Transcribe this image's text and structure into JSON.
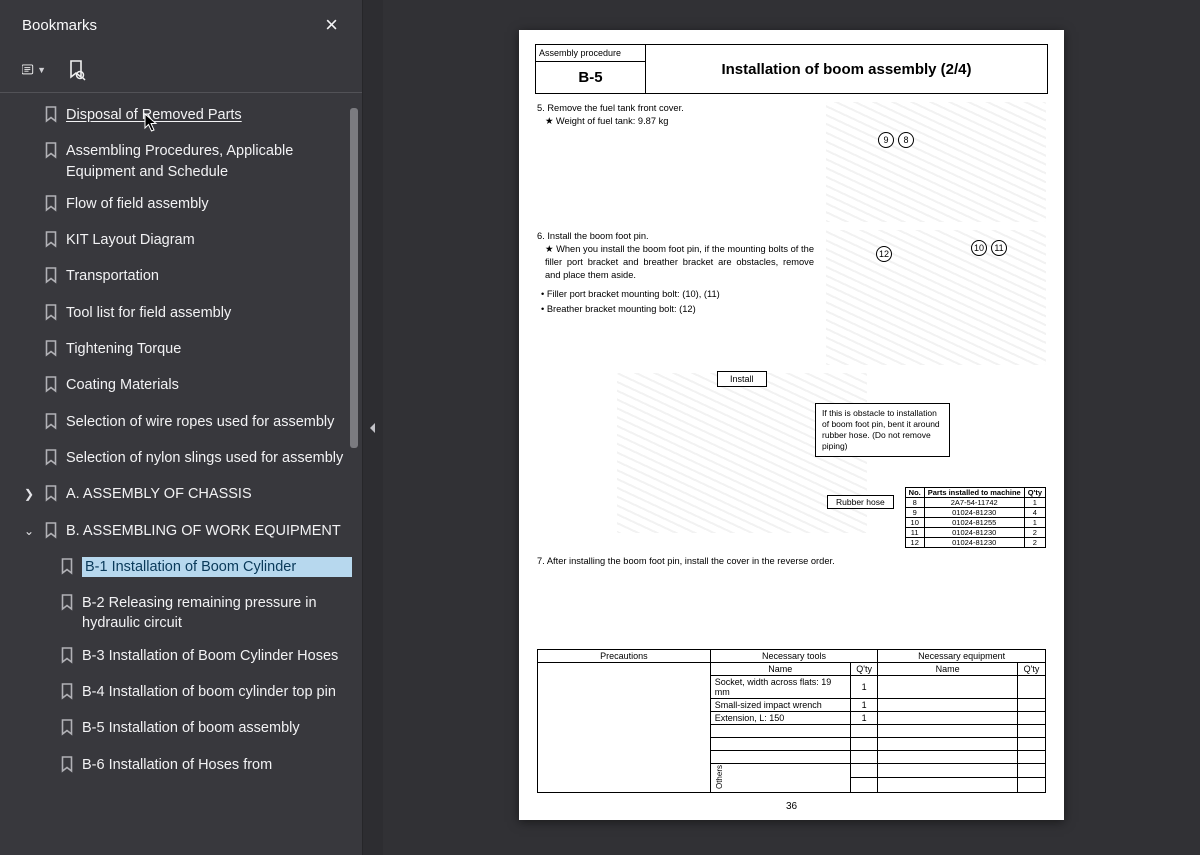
{
  "sidebar": {
    "title": "Bookmarks",
    "items": [
      {
        "label": "Disposal of Removed Parts",
        "lvl": 1,
        "expand": "",
        "underlined": true
      },
      {
        "label": "Assembling Procedures, Applicable Equipment and Schedule",
        "lvl": 1,
        "expand": ""
      },
      {
        "label": "Flow of field assembly",
        "lvl": 1,
        "expand": ""
      },
      {
        "label": "KIT Layout Diagram",
        "lvl": 1,
        "expand": ""
      },
      {
        "label": "Transportation",
        "lvl": 1,
        "expand": ""
      },
      {
        "label": "Tool list for field assembly",
        "lvl": 1,
        "expand": ""
      },
      {
        "label": "Tightening Torque",
        "lvl": 1,
        "expand": ""
      },
      {
        "label": "Coating Materials",
        "lvl": 1,
        "expand": ""
      },
      {
        "label": "Selection of wire ropes used for assembly",
        "lvl": 1,
        "expand": ""
      },
      {
        "label": "Selection of nylon slings used for assembly",
        "lvl": 1,
        "expand": ""
      },
      {
        "label": "A. ASSEMBLY OF CHASSIS",
        "lvl": 1,
        "expand": ">"
      },
      {
        "label": "B. ASSEMBLING OF WORK EQUIPMENT",
        "lvl": 1,
        "expand": "v"
      },
      {
        "label": "B-1  Installation of Boom Cylinder",
        "lvl": 2,
        "expand": "",
        "selected": true
      },
      {
        "label": "B-2  Releasing remaining pressure in hydraulic circuit",
        "lvl": 2,
        "expand": ""
      },
      {
        "label": "B-3  Installation of Boom Cylinder Hoses",
        "lvl": 2,
        "expand": ""
      },
      {
        "label": "B-4  Installation of boom cylinder top pin",
        "lvl": 2,
        "expand": ""
      },
      {
        "label": "B-5  Installation of boom assembly",
        "lvl": 2,
        "expand": ""
      },
      {
        "label": "B-6  Installation of Hoses from",
        "lvl": 2,
        "expand": ""
      }
    ]
  },
  "page": {
    "proc_label": "Assembly procedure",
    "code": "B-5",
    "title": "Installation of boom assembly (2/4)",
    "step5": {
      "text": "5. Remove the fuel tank front cover.",
      "sub": "★ Weight of fuel tank: 9.87 kg",
      "callouts": [
        "9",
        "8"
      ]
    },
    "step6": {
      "text": "6. Install the boom foot pin.",
      "sub": "★ When you install the boom foot pin, if the mounting bolts of the filler port bracket and breather bracket are obstacles, remove and place them aside.",
      "b1": "• Filler port bracket mounting bolt: (10), (11)",
      "b2": "• Breather bracket mounting bolt: (12)",
      "callouts": [
        "12",
        "10",
        "11"
      ]
    },
    "install_label": "Install",
    "note_box": "If this is obstacle to installation of boom foot pin, bent it around rubber hose.\n(Do not remove piping)",
    "rubber_label": "Rubber hose",
    "parts_table": {
      "headers": [
        "No.",
        "Parts installed to machine",
        "Q'ty"
      ],
      "rows": [
        [
          "8",
          "2A7-54-11742",
          "1"
        ],
        [
          "9",
          "01024-81230",
          "4"
        ],
        [
          "10",
          "01024-81255",
          "1"
        ],
        [
          "11",
          "01024-81230",
          "2"
        ],
        [
          "12",
          "01024-81230",
          "2"
        ]
      ]
    },
    "step7": "7. After installing the boom foot pin, install the cover in the reverse order.",
    "btm": {
      "h_prec": "Precautions",
      "h_tools": "Necessary tools",
      "h_equip": "Necessary equipment",
      "h_name": "Name",
      "h_qty": "Q'ty",
      "tools": [
        {
          "name": "Socket, width across flats: 19 mm",
          "qty": "1"
        },
        {
          "name": "Small-sized impact wrench",
          "qty": "1"
        },
        {
          "name": "Extension, L: 150",
          "qty": "1"
        }
      ],
      "others": "Others"
    },
    "num": "36"
  }
}
